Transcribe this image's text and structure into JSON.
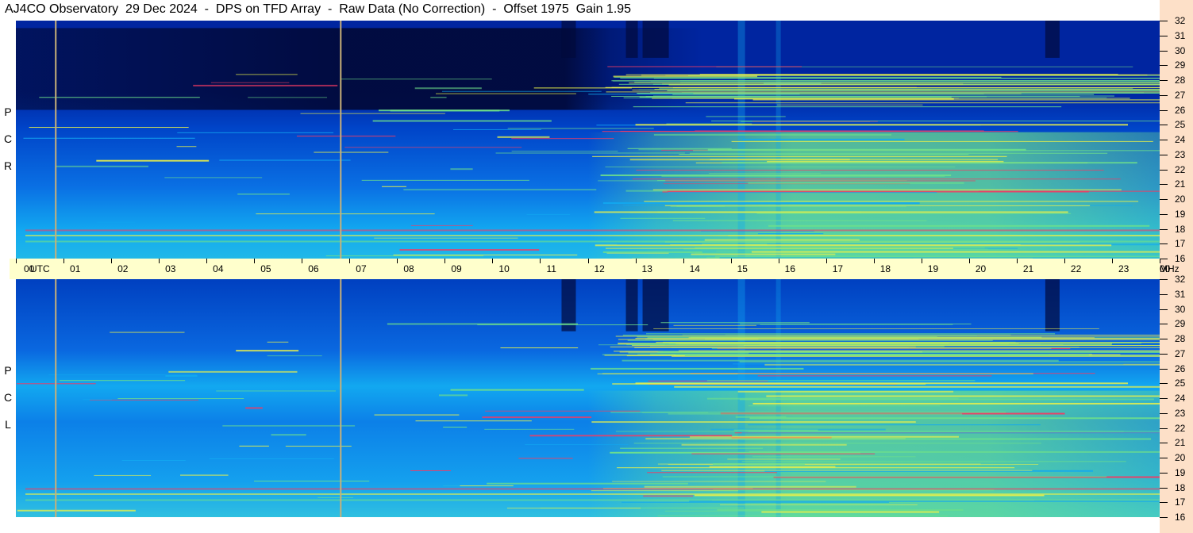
{
  "header": {
    "title": "AJ4CO Observatory  29 Dec 2024  -  DPS on TFD Array  -  Raw Data (No Correction)  -  Offset 1975  Gain 1.95"
  },
  "chart_data": {
    "type": "heatmap",
    "panels": [
      {
        "name": "RCP",
        "label_letters": [
          "R",
          "C",
          "P"
        ]
      },
      {
        "name": "LCP",
        "label_letters": [
          "L",
          "C",
          "P"
        ]
      }
    ],
    "x_ticks": [
      "00",
      "01",
      "02",
      "03",
      "04",
      "05",
      "06",
      "07",
      "08",
      "09",
      "10",
      "11",
      "12",
      "13",
      "14",
      "15",
      "16",
      "17",
      "18",
      "19",
      "20",
      "21",
      "22",
      "23",
      "00"
    ],
    "x_unit": "UTC",
    "y_ticks": [
      "16",
      "17",
      "18",
      "19",
      "20",
      "21",
      "22",
      "23",
      "24",
      "25",
      "26",
      "27",
      "28",
      "29",
      "30",
      "31",
      "32"
    ],
    "y_unit": "MHz",
    "x_range_hours": [
      0,
      24
    ],
    "y_range_mhz": [
      16,
      32
    ],
    "vertical_markers_hours": [
      0.82,
      6.8
    ],
    "colors": {
      "dark": "#010a3c",
      "deep_blue": "#0025a0",
      "blue": "#0a5ae0",
      "cyan": "#12a8f0",
      "green": "#6ee08a",
      "yellow": "#e8f04a",
      "red": "#f03c64",
      "marker": "#c8b078",
      "time_band": "#ffffcc",
      "right_strip": "#fde0c8"
    }
  }
}
